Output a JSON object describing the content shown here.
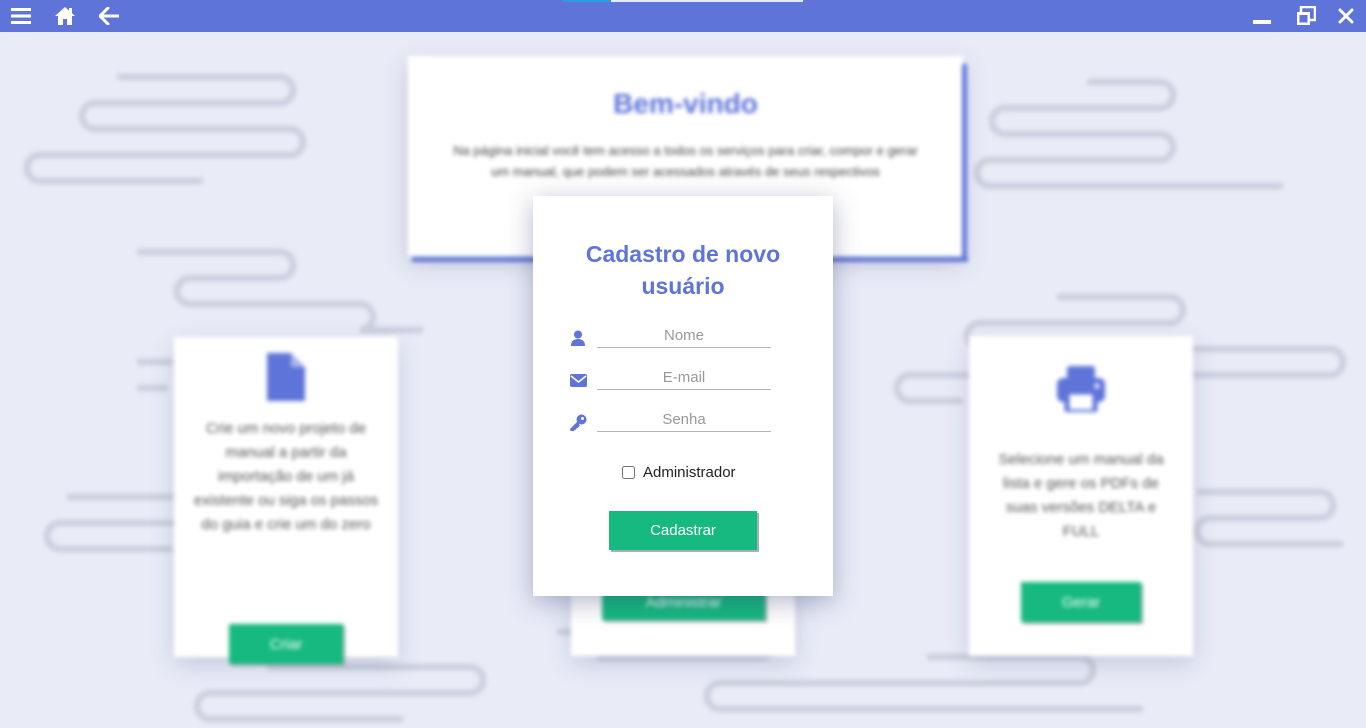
{
  "titlebar": {
    "icons": {
      "menu": "menu-icon",
      "home": "home-icon",
      "back": "arrow-left-icon",
      "minimize": "minimize-icon",
      "restore": "restore-icon",
      "close": "close-icon"
    }
  },
  "background": {
    "welcome": {
      "title": "Bem-vindo",
      "text": "Na página inicial você tem acesso a todos os serviços para criar, compor e gerar um manual, que podem ser acessados através de seus respectivos"
    },
    "card_create": {
      "icon": "file-icon",
      "text": "Crie um novo projeto de manual a partir da importação de um já existente ou siga os passos do guia e crie um do zero",
      "button": "Criar"
    },
    "card_admin": {
      "button": "Administrar"
    },
    "card_generate": {
      "icon": "printer-icon",
      "text": "Selecione um manual da lista e gere os PDFs de suas versões DELTA e FULL",
      "button": "Gerar"
    }
  },
  "dialog": {
    "title": "Cadastro de novo usuário",
    "fields": {
      "name": {
        "placeholder": "Nome",
        "value": ""
      },
      "email": {
        "placeholder": "E-mail",
        "value": ""
      },
      "password": {
        "placeholder": "Senha",
        "value": ""
      }
    },
    "admin_checkbox_label": "Administrador",
    "admin_checked": false,
    "submit_label": "Cadastrar"
  },
  "colors": {
    "accent": "#5f74d8",
    "button": "#16b97f",
    "background": "#e9ecf7"
  }
}
